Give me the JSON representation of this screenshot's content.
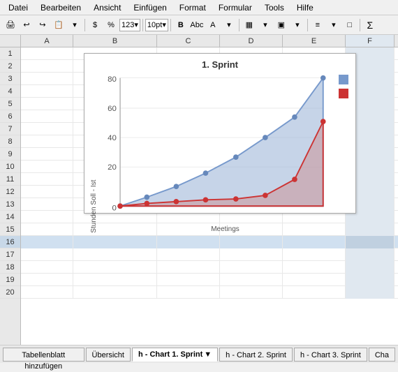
{
  "menubar": {
    "items": [
      "Datei",
      "Bearbeiten",
      "Ansicht",
      "Einfügen",
      "Format",
      "Formular",
      "Tools",
      "Hilfe"
    ]
  },
  "toolbar": {
    "buttons": [
      "🖨",
      "↩",
      "↪",
      "📷",
      "$",
      "%",
      "123",
      "10pt",
      "B",
      "Abc",
      "A",
      "▦",
      "▣",
      "≡",
      "□",
      "Σ"
    ]
  },
  "columns": [
    "A",
    "B",
    "C",
    "D",
    "E",
    "F"
  ],
  "rows": [
    1,
    2,
    3,
    4,
    5,
    6,
    7,
    8,
    9,
    10,
    11,
    12,
    13,
    14,
    15,
    16,
    17,
    18,
    19,
    20
  ],
  "chart": {
    "title": "1. Sprint",
    "yaxis_label": "Stunden Soll - Ist",
    "xaxis_label": "Meetings",
    "y_ticks": [
      80,
      60,
      40,
      20,
      0
    ],
    "legend": [
      {
        "color": "#6699cc",
        "label": ""
      },
      {
        "color": "#cc3333",
        "label": ""
      }
    ]
  },
  "tabs": {
    "add_sheet": "Tabellenblatt hinzufügen",
    "items": [
      {
        "label": "Übersicht",
        "active": false
      },
      {
        "label": "h - Chart 1. Sprint",
        "active": true,
        "has_arrow": true
      },
      {
        "label": "h - Chart 2. Sprint",
        "active": false
      },
      {
        "label": "h - Chart 3. Sprint",
        "active": false
      },
      {
        "label": "Cha",
        "active": false
      }
    ]
  }
}
